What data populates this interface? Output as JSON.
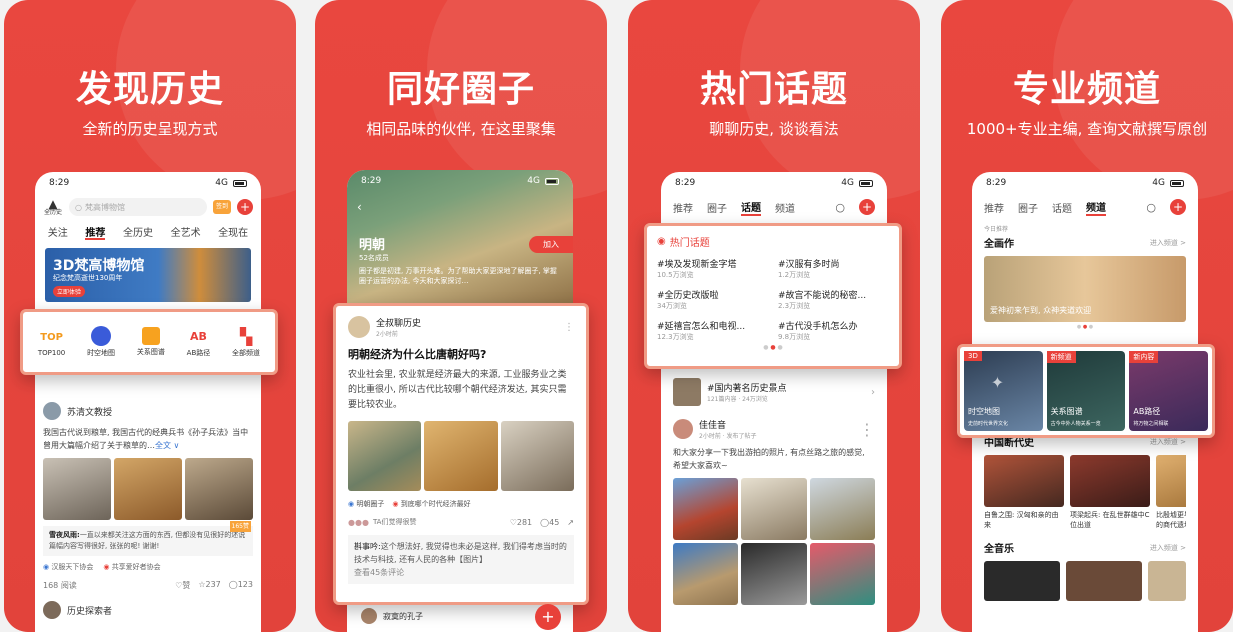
{
  "panels": [
    {
      "title": "发现历史",
      "subtitle": "全新的历史呈现方式"
    },
    {
      "title": "同好圈子",
      "subtitle": "相同品味的伙伴, 在这里聚集"
    },
    {
      "title": "热门话题",
      "subtitle": "聊聊历史, 谈谈看法"
    },
    {
      "title": "专业频道",
      "subtitle": "1000+专业主编, 查询文献撰写原创"
    }
  ],
  "status": {
    "time": "8:29",
    "net": "4G"
  },
  "p1": {
    "logo": "全历史",
    "search_placeholder": "梵高博物馆",
    "badge": "签到",
    "tabs": [
      "关注",
      "推荐",
      "全历史",
      "全艺术",
      "全现在"
    ],
    "banner_title": "3D梵高博物馆",
    "banner_sub": "纪念梵高逝世130周年",
    "banner_btn": "立即体验",
    "shortcuts": [
      "TOP100",
      "时空地图",
      "关系图谱",
      "AB路径",
      "全部频道"
    ],
    "post_author": "苏清文教授",
    "post_text": "我国古代说到粮草, 我国古代的经典兵书《孙子兵法》当中曾用大篇幅介绍了关于粮草的…",
    "more": "全文 ∨",
    "comment_user": "雪夜风雨:",
    "comment_text": "一直以来都关注这方面的东西, 但都没有见很好的述说篇幅内容写得很好, 张张的呢! 谢谢!",
    "hot": "165赞",
    "tags": [
      "汉服天下协会",
      "共享爱好者协会"
    ],
    "reads": "168 阅读",
    "like": "赞",
    "stars": "237",
    "comments": "123",
    "next_author": "历史探索者"
  },
  "p2": {
    "circle_name": "明朝",
    "members": "52名成员",
    "join": "加入",
    "circle_desc": "圈子都是初建, 万事开头难。为了帮助大家更深地了解圈子, 掌握圈子运营的办法, 今天和大家探讨…",
    "author": "全叔聊历史",
    "time": "2小时前",
    "question": "明朝经济为什么比唐朝好吗?",
    "body": "农业社会里, 农业就是经济最大的来源, 工业服务业之类的比重很小, 所以古代比较哪个朝代经济发达, 其实只需要比较农业。",
    "tags": [
      "明朝圈子",
      "到底哪个时代经济最好"
    ],
    "voted": "TA们觉得很赞",
    "likes": "281",
    "comments": "45",
    "reply_user": "斟事吟:",
    "reply_text": "这个想法好, 我觉得也未必是这样, 我们得考虑当时的技术与科技, 还有人民的各种【图片】",
    "more_replies": "查看45条评论",
    "next_author": "寂寞的孔子"
  },
  "p3": {
    "tabs": [
      "推荐",
      "圈子",
      "话题",
      "频道"
    ],
    "hot_title": "热门话题",
    "topics": [
      {
        "name": "#埃及发现新金字塔",
        "views": "10.5万浏览"
      },
      {
        "name": "#汉服有多时尚",
        "views": "1.2万浏览"
      },
      {
        "name": "#全历史改版啦",
        "views": "34万浏览"
      },
      {
        "name": "#故宫不能说的秘密...",
        "views": "2.3万浏览"
      },
      {
        "name": "#延禧宫怎么和电视...",
        "views": "12.3万浏览"
      },
      {
        "name": "#古代没手机怎么办",
        "views": "9.8万浏览"
      }
    ],
    "below_topic": "#国内著名历史景点",
    "below_views": "121篇内容 · 24万浏览",
    "author": "佳佳音",
    "time": "2小时前 · 发布了帖子",
    "text": "和大家分享一下我出游拍的照片, 有点丝路之旅的感觉, 希望大家喜欢~"
  },
  "p4": {
    "tabs": [
      "推荐",
      "圈子",
      "话题",
      "频道"
    ],
    "today": "今日推荐",
    "section1": "全画作",
    "enter": "进入频道 >",
    "hero_text": "爱神初来乍到, 众神夹道欢迎",
    "cards": [
      {
        "badge": "3D",
        "title": "时空地图",
        "sub": "史前时代世界文化"
      },
      {
        "badge": "新频道",
        "title": "关系图谱",
        "sub": "古今中外人物关系一览"
      },
      {
        "badge": "新内容",
        "title": "AB路径",
        "sub": "将万物之间相联"
      }
    ],
    "section2": "中国断代史",
    "thumbs": [
      "自鲁之围: 汉匈和亲的由来",
      "项梁起兵: 在乱世群雄中C位出道",
      "比殷墟更早的商代遗址"
    ],
    "section3": "全音乐"
  },
  "colors": {
    "red": "#e8413a",
    "bg": "#e2433b",
    "card_border": "#f09b85"
  }
}
